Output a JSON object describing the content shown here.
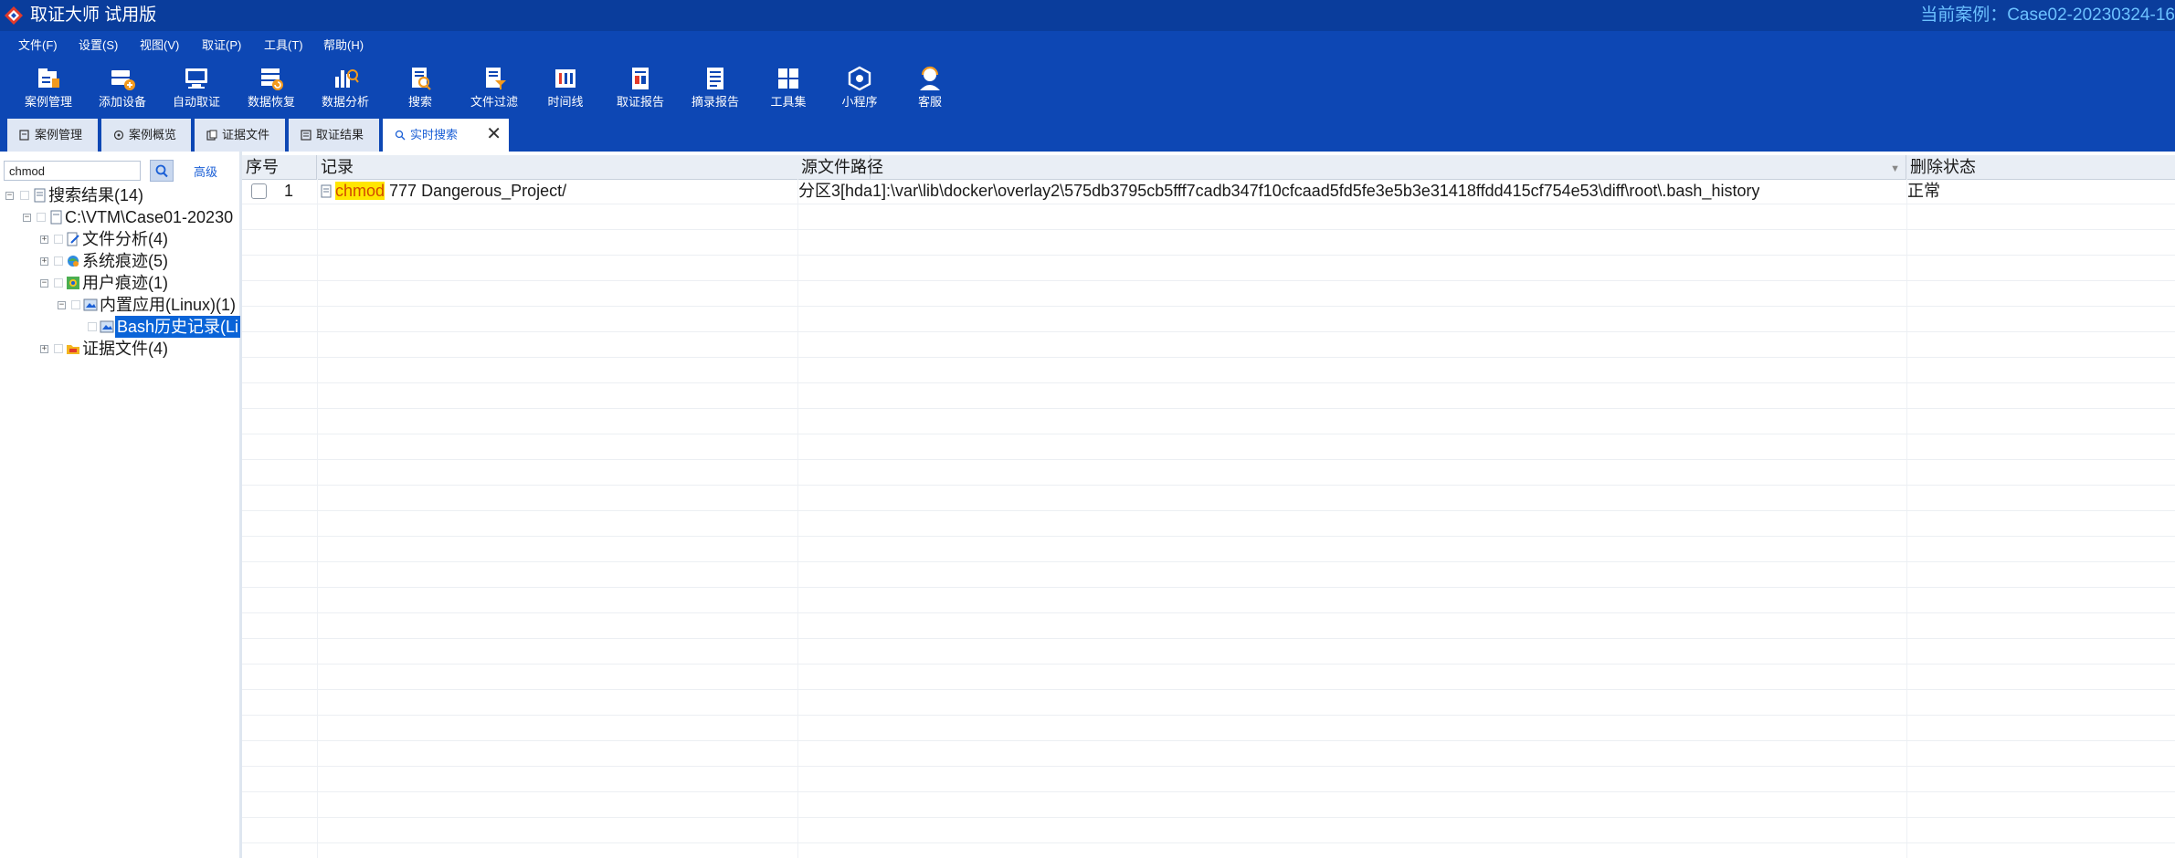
{
  "titlebar": {
    "title": "取证大师 试用版",
    "current_case": "当前案例：Case02-20230324-16"
  },
  "menu": [
    "文件(F)",
    "设置(S)",
    "视图(V)",
    "取证(P)",
    "工具(T)",
    "帮助(H)"
  ],
  "toolbar": [
    {
      "label": "案例管理",
      "icon": "case-management-icon"
    },
    {
      "label": "添加设备",
      "icon": "add-device-icon"
    },
    {
      "label": "自动取证",
      "icon": "auto-forensics-icon"
    },
    {
      "label": "数据恢复",
      "icon": "data-recovery-icon"
    },
    {
      "label": "数据分析",
      "icon": "data-analysis-icon"
    },
    {
      "label": "搜索",
      "icon": "search-icon"
    },
    {
      "label": "文件过滤",
      "icon": "file-filter-icon"
    },
    {
      "label": "时间线",
      "icon": "timeline-icon"
    },
    {
      "label": "取证报告",
      "icon": "forensic-report-icon"
    },
    {
      "label": "摘录报告",
      "icon": "excerpt-report-icon"
    },
    {
      "label": "工具集",
      "icon": "toolset-icon"
    },
    {
      "label": "小程序",
      "icon": "mini-program-icon"
    },
    {
      "label": "客服",
      "icon": "customer-service-icon"
    }
  ],
  "tabs": [
    {
      "label": "案例管理"
    },
    {
      "label": "案例概览"
    },
    {
      "label": "证据文件"
    },
    {
      "label": "取证结果"
    },
    {
      "label": "实时搜索",
      "active": true
    }
  ],
  "search": {
    "value": "chmod",
    "advanced_label": "高级"
  },
  "tree": [
    {
      "label": "搜索结果(14)",
      "icon": "search-results-icon"
    },
    {
      "label": "C:\\VTM\\Case01-20230",
      "icon": "case-file-icon"
    },
    {
      "label": "文件分析(4)",
      "icon": "file-analysis-icon"
    },
    {
      "label": "系统痕迹(5)",
      "icon": "system-traces-icon"
    },
    {
      "label": "用户痕迹(1)",
      "icon": "user-traces-icon"
    },
    {
      "label": "内置应用(Linux)(1)",
      "icon": "builtin-app-icon"
    },
    {
      "label": "Bash历史记录(Li",
      "icon": "bash-history-icon",
      "selected": true
    },
    {
      "label": "证据文件(4)",
      "icon": "evidence-folder-icon"
    }
  ],
  "grid": {
    "columns": [
      "序号",
      "记录",
      "源文件路径",
      "删除状态"
    ],
    "rows": [
      {
        "index": "1",
        "record_highlight": "chmod",
        "record_rest": " 777 Dangerous_Project/",
        "source_path": "分区3[hda1]:\\var\\lib\\docker\\overlay2\\575db3795cb5fff7cadb347f10cfcaad5fd5fe3e5b3e31418ffdd415cf754e53\\diff\\root\\.bash_history",
        "status": "正常"
      }
    ]
  },
  "colors": {
    "titlebar": "#0a3d9c",
    "toolbar": "#0d47b4",
    "current_case": "#6cc1ff",
    "highlight_bg": "#ffe600",
    "highlight_text": "#d24a00",
    "selection": "#0a64d8"
  }
}
